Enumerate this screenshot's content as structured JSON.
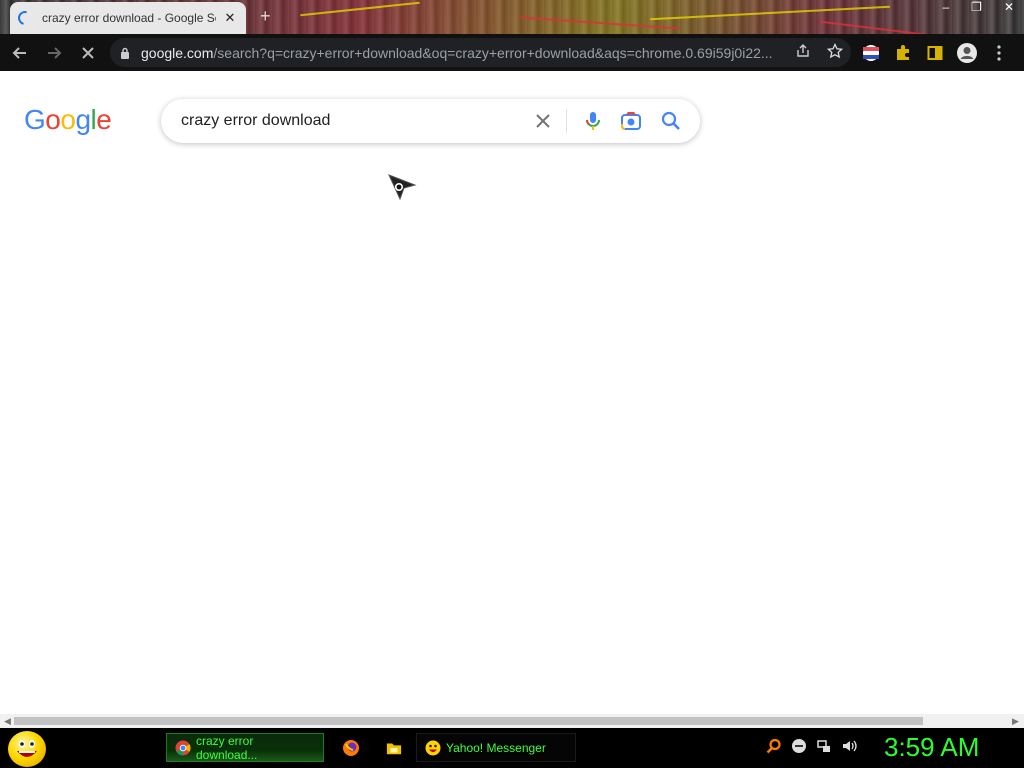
{
  "browser": {
    "tab": {
      "title": "crazy error download - Google Search",
      "close_label": "✕"
    },
    "new_tab_label": "+",
    "window_controls": {
      "minimize": "–",
      "maximize": "❐",
      "close": "✕"
    },
    "url_domain": "google.com",
    "url_rest": "/search?q=crazy+error+download&oq=crazy+error+download&aqs=chrome.0.69i59j0i22..."
  },
  "page": {
    "logo": [
      "G",
      "o",
      "o",
      "g",
      "l",
      "e"
    ],
    "logo_colors": [
      "#4285F4",
      "#EA4335",
      "#FBBC05",
      "#4285F4",
      "#34A853",
      "#EA4335"
    ],
    "search": {
      "value": "crazy error download"
    }
  },
  "taskbar": {
    "tasks": [
      {
        "label": "crazy error download..."
      },
      {
        "label": "Yahoo! Messenger"
      }
    ],
    "clock": "3:59 AM"
  },
  "colors": {
    "clock": "#2bff2b",
    "taskbar_text": "#3cff3c",
    "google_blue": "#4285F4"
  }
}
